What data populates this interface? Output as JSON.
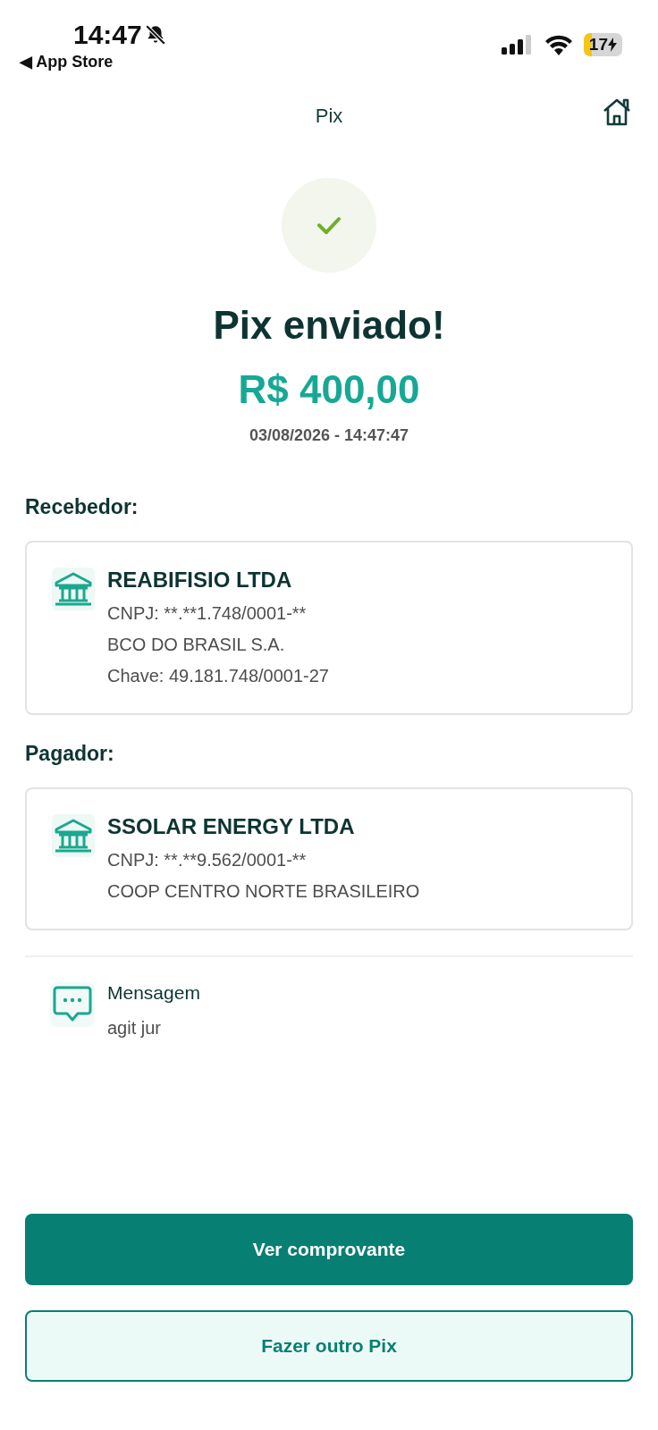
{
  "status_bar": {
    "time": "14:47",
    "back_link": "◀ App Store",
    "battery": "17"
  },
  "header": {
    "title": "Pix"
  },
  "result": {
    "title": "Pix enviado!",
    "amount": "R$ 400,00",
    "datetime": "03/08/2026 - 14:47:47"
  },
  "parties": [
    {
      "heading": "Recebedor:",
      "name": "REABIFISIO LTDA",
      "lines": [
        "CNPJ: **.**1.748/0001-**",
        "BCO DO BRASIL S.A.",
        "Chave: 49.181.748/0001-27"
      ]
    },
    {
      "heading": "Pagador:",
      "name": "SSOLAR ENERGY LTDA",
      "lines": [
        "CNPJ: **.**9.562/0001-**",
        "COOP CENTRO NORTE BRASILEIRO"
      ]
    }
  ],
  "message": {
    "label": "Mensagem",
    "text": "agit jur"
  },
  "buttons": [
    {
      "label": "Ver comprovante",
      "kind": "primary"
    },
    {
      "label": "Fazer outro Pix",
      "kind": "secondary"
    }
  ]
}
